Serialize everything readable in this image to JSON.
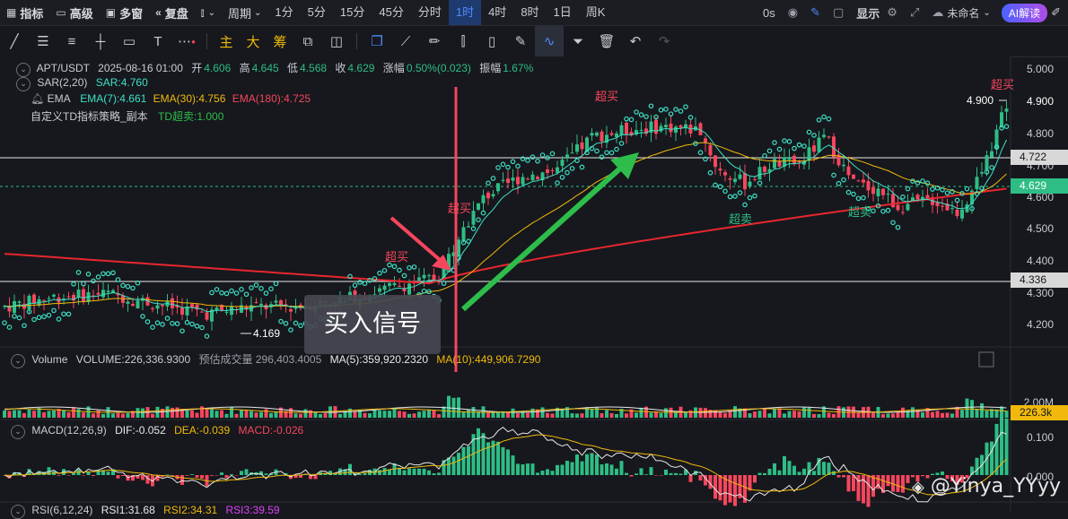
{
  "topbar": {
    "items": [
      {
        "icon": "indicators-icon",
        "label": "指标"
      },
      {
        "icon": "advanced-icon",
        "label": "高级"
      },
      {
        "icon": "multi-window-icon",
        "label": "多窗"
      },
      {
        "icon": "replay-icon",
        "label": "复盘"
      },
      {
        "icon": "candle-type-icon",
        "label": ""
      },
      {
        "icon": "period-icon",
        "label": "周期"
      }
    ],
    "timeframes": [
      "1分",
      "5分",
      "15分",
      "45分",
      "分时",
      "1时",
      "4时",
      "8时",
      "1日",
      "周K"
    ],
    "active_timeframe": "1时",
    "countdown": "0s",
    "display_label": "显示",
    "layout_name": "未命名",
    "ai_label": "AI解读"
  },
  "drawing_toolbar": {
    "cn_buttons": [
      "主",
      "大",
      "筹"
    ]
  },
  "main_legend": {
    "symbol": "APT/USDT",
    "datetime": "2025-08-16 01:00",
    "open_label": "开",
    "open": "4.606",
    "high_label": "高",
    "high": "4.645",
    "low_label": "低",
    "low": "4.568",
    "close_label": "收",
    "close": "4.629",
    "change_label": "涨幅",
    "change": "0.50%(0.023)",
    "amp_label": "振幅",
    "amp": "1.67%",
    "sar_name": "SAR(2,20)",
    "sar_value": "SAR:4.760",
    "ema_name": "EMA",
    "ema7": "EMA(7):4.661",
    "ema30": "EMA(30):4.756",
    "ema180": "EMA(180):4.725",
    "td_name": "自定义TD指标策略_副本",
    "td_value": "TD超卖:1.000"
  },
  "price_axis": [
    "5.000",
    "4.900",
    "4.800",
    "4.700",
    "4.600",
    "4.500",
    "4.400",
    "4.300",
    "4.200"
  ],
  "price_tags": {
    "line_upper": "4.722",
    "current": "4.629",
    "line_lower": "4.336",
    "high_mark": "4.900",
    "low_mark": "4.169"
  },
  "chart_labels": {
    "overbought": "超买",
    "oversold": "超卖",
    "buy_signal": "买入信号"
  },
  "volume_legend": {
    "name": "Volume",
    "volume": "VOLUME:226,336.9300",
    "est_label": "预估成交量",
    "est": "296,403.4005",
    "ma5": "MA(5):359,920.2320",
    "ma10": "MA(10):449,906.7290"
  },
  "volume_axis": {
    "tick": "2.00M",
    "current": "226.3k"
  },
  "macd_legend": {
    "name": "MACD(12,26,9)",
    "dif": "DIF:-0.052",
    "dea": "DEA:-0.039",
    "macd": "MACD:-0.026"
  },
  "macd_axis": [
    "0.100",
    "0.000"
  ],
  "rsi_legend": {
    "name": "RSI(6,12,24)",
    "rsi1": "RSI1:31.68",
    "rsi2": "RSI2:34.31",
    "rsi3": "RSI3:39.59"
  },
  "watermark": "@Yinya_YYyy",
  "colors": {
    "up": "#2ebd85",
    "down": "#f6465d",
    "ema7": "#3ee0c5",
    "ema30": "#f0b90b",
    "ema180": "#e8262e",
    "sar": "#3ee0c5",
    "accent": "#4e8cff"
  },
  "chart_data": {
    "type": "candlestick",
    "price_range": [
      4.15,
      5.02
    ],
    "series": [
      {
        "name": "EMA(180)",
        "values_approx": [
          4.43,
          4.4,
          4.37,
          4.34,
          4.34,
          4.37,
          4.45,
          4.52,
          4.57,
          4.6,
          4.62
        ]
      },
      {
        "name": "EMA(30)",
        "values_approx": [
          4.3,
          4.3,
          4.29,
          4.29,
          4.31,
          4.43,
          4.6,
          4.75,
          4.7,
          4.68,
          4.72
        ]
      },
      {
        "name": "EMA(7)",
        "values_approx": [
          4.27,
          4.3,
          4.27,
          4.26,
          4.3,
          4.58,
          4.72,
          4.8,
          4.66,
          4.58,
          4.78
        ]
      }
    ]
  }
}
